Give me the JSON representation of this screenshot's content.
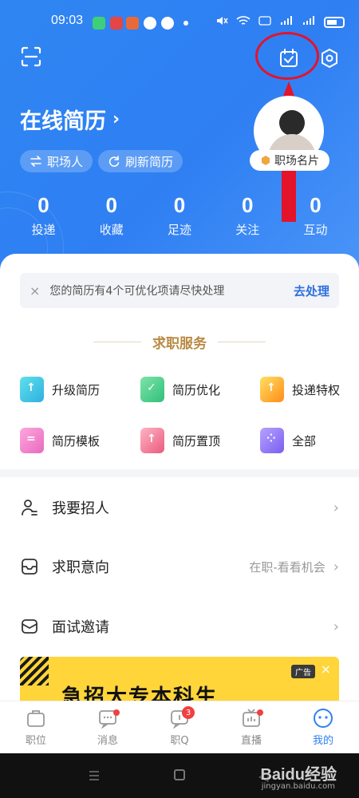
{
  "status": {
    "time": "09:03"
  },
  "header": {
    "title": "在线简历",
    "title_chevron": "›",
    "pill_switch": "职场人",
    "pill_refresh": "刷新简历",
    "card_badge": "职场名片"
  },
  "stats": [
    {
      "value": "0",
      "label": "投递"
    },
    {
      "value": "0",
      "label": "收藏"
    },
    {
      "value": "0",
      "label": "足迹"
    },
    {
      "value": "0",
      "label": "关注"
    },
    {
      "value": "0",
      "label": "互动"
    }
  ],
  "tip": {
    "text": "您的简历有4个可优化项请尽快处理",
    "action": "去处理",
    "close": "×"
  },
  "services": {
    "title": "求职服务",
    "items": [
      {
        "label": "升级简历",
        "icon": "upgrade-resume-icon",
        "color": "#38c6d8"
      },
      {
        "label": "简历优化",
        "icon": "resume-optimize-icon",
        "color": "#3ecf8e"
      },
      {
        "label": "投递特权",
        "icon": "delivery-privilege-icon",
        "color": "#ffb020"
      },
      {
        "label": "简历模板",
        "icon": "resume-template-icon",
        "color": "#f57fc6"
      },
      {
        "label": "简历置顶",
        "icon": "resume-top-icon",
        "color": "#f26b8a"
      },
      {
        "label": "全部",
        "icon": "all-icon",
        "color": "#8a6ff0"
      }
    ]
  },
  "menu": [
    {
      "label": "我要招人",
      "value": ""
    },
    {
      "label": "求职意向",
      "value": "在职-看看机会"
    },
    {
      "label": "面试邀请",
      "value": ""
    }
  ],
  "ad": {
    "text": "急招大专本科生",
    "tag": "广告",
    "close": "×"
  },
  "bottom_nav": [
    {
      "label": "职位",
      "badge": ""
    },
    {
      "label": "消息",
      "badge": ""
    },
    {
      "label": "职Q",
      "badge": "3"
    },
    {
      "label": "直播",
      "badge": ""
    },
    {
      "label": "我的",
      "badge": ""
    }
  ],
  "watermark": {
    "brand": "Baidu经验",
    "url": "jingyan.baidu.com"
  }
}
